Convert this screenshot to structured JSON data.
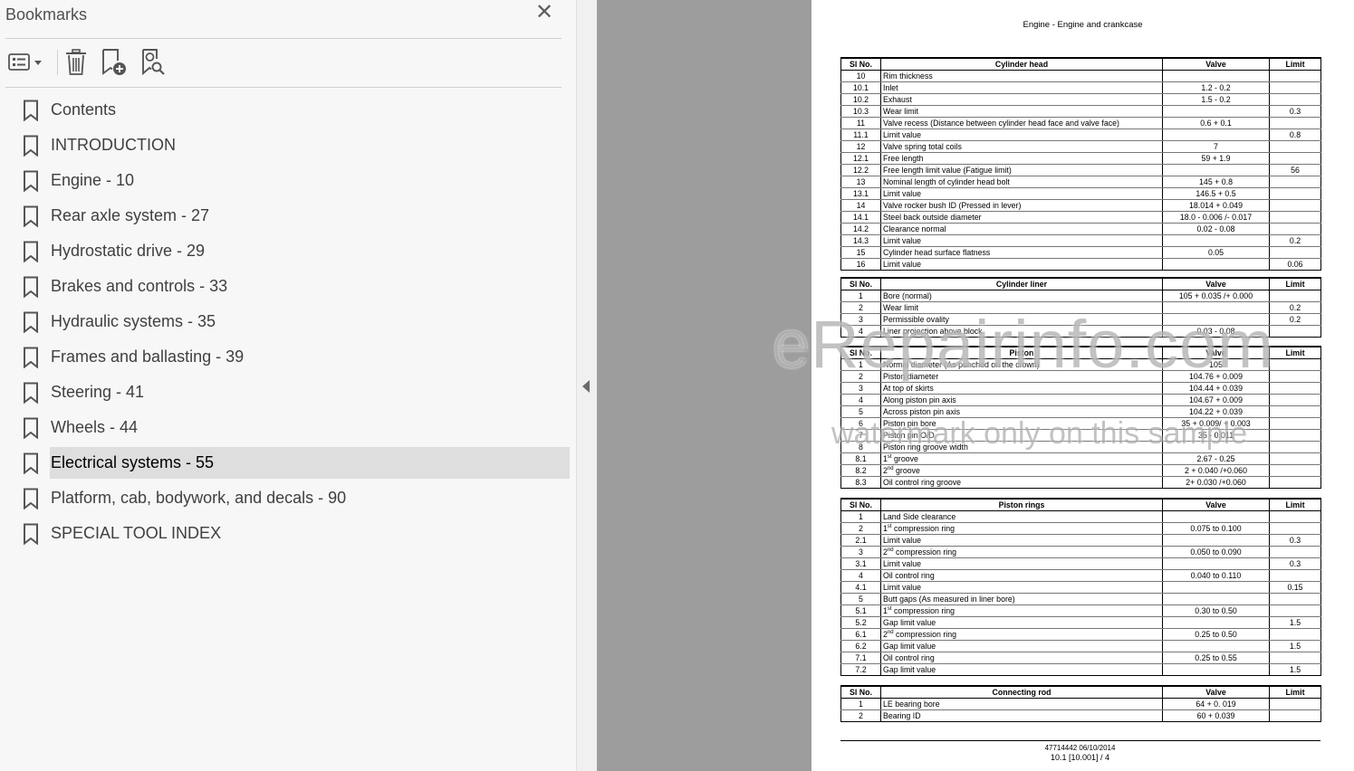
{
  "panel": {
    "title": "Bookmarks",
    "close_symbol": "✕"
  },
  "toolbar": {
    "options": {
      "icon": "list-options-icon"
    },
    "delete": {
      "icon": "trash-icon"
    },
    "new_bookmark": {
      "icon": "add-bookmark-icon"
    },
    "find_bookmark": {
      "icon": "find-bookmark-icon"
    }
  },
  "bookmarks": [
    {
      "label": "Contents"
    },
    {
      "label": "INTRODUCTION"
    },
    {
      "label": "Engine - 10"
    },
    {
      "label": "Rear axle system - 27"
    },
    {
      "label": "Hydrostatic drive - 29"
    },
    {
      "label": "Brakes and controls - 33"
    },
    {
      "label": "Hydraulic systems - 35"
    },
    {
      "label": "Frames and ballasting - 39"
    },
    {
      "label": "Steering - 41"
    },
    {
      "label": "Wheels - 44"
    },
    {
      "label": "Electrical systems - 55",
      "selected": true
    },
    {
      "label": "Platform, cab, bodywork, and decals - 90"
    },
    {
      "label": "SPECIAL TOOL INDEX"
    }
  ],
  "document": {
    "header": "Engine - Engine and crankcase",
    "tables": [
      {
        "headers": [
          "Sl No.",
          "Cylinder head",
          "Valve",
          "Limit"
        ],
        "rows": [
          [
            "10",
            "Rim thickness",
            "",
            ""
          ],
          [
            "10.1",
            "Inlet",
            "1.2 - 0.2",
            ""
          ],
          [
            "10.2",
            "Exhaust",
            "1.5 - 0.2",
            ""
          ],
          [
            "10.3",
            "Wear limit",
            "",
            "0.3"
          ],
          [
            "11",
            "Valve recess (Distance between cylinder head face and valve face)",
            "0.6 + 0.1",
            ""
          ],
          [
            "11.1",
            "Limit value",
            "",
            "0.8"
          ],
          [
            "12",
            "Valve spring total coils",
            "7",
            ""
          ],
          [
            "12.1",
            "Free length",
            "59 + 1.9",
            ""
          ],
          [
            "12.2",
            "Free length limit value (Fatigue limit)",
            "",
            "56"
          ],
          [
            "13",
            "Nominal length of cylinder head bolt",
            "145 + 0.8",
            ""
          ],
          [
            "13.1",
            "Limit value",
            "146.5 + 0.5",
            ""
          ],
          [
            "14",
            "Valve rocker bush ID (Pressed in lever)",
            "18.014 + 0.049",
            ""
          ],
          [
            "14.1",
            "Steel back outside diameter",
            "18.0 - 0.006 /- 0.017",
            ""
          ],
          [
            "14.2",
            "Clearance normal",
            "0.02 - 0.08",
            ""
          ],
          [
            "14.3",
            "Limit value",
            "",
            "0.2"
          ],
          [
            "15",
            "Cylinder head surface flatness",
            "0.05",
            ""
          ],
          [
            "16",
            "Limit value",
            "",
            "0.06"
          ]
        ]
      },
      {
        "headers": [
          "Sl No.",
          "Cylinder liner",
          "Valve",
          "Limit"
        ],
        "rows": [
          [
            "1",
            "Bore (normal)",
            "105 + 0.035 /+ 0.000",
            ""
          ],
          [
            "2",
            "Wear limit",
            "",
            "0.2"
          ],
          [
            "3",
            "Permissible ovality",
            "",
            "0.2"
          ],
          [
            "4",
            "Liner projection above block",
            "0.03 - 0.08",
            ""
          ]
        ]
      },
      {
        "headers": [
          "Sl No.",
          "Piston",
          "Valve",
          "Limit"
        ],
        "rows": [
          [
            "1",
            "Normal diameter (As punched on the crown)",
            "105",
            ""
          ],
          [
            "2",
            "Piston diameter",
            "104.76 + 0.009",
            ""
          ],
          [
            "3",
            "At top of skirts",
            "104.44 + 0.039",
            ""
          ],
          [
            "4",
            "Along piston pin axis",
            "104.67 + 0.009",
            ""
          ],
          [
            "5",
            "Across piston pin axis",
            "104.22 + 0.039",
            ""
          ],
          [
            "6",
            "Piston pin bore",
            "35 + 0.009/ + 0.003",
            ""
          ],
          [
            "7",
            "Piston pin O/D",
            "35 - 0.011",
            ""
          ],
          [
            "8",
            "Piston ring groove width",
            "",
            ""
          ],
          [
            "8.1",
            "1|st| groove",
            "2.67 - 0.25",
            ""
          ],
          [
            "8.2",
            "2|nd| groove",
            "2 + 0.040 /+0.060",
            ""
          ],
          [
            "8.3",
            "Oil control ring groove",
            "2+ 0.030 /+0.060",
            ""
          ]
        ]
      },
      {
        "headers": [
          "Sl No.",
          "Piston rings",
          "Valve",
          "Limit"
        ],
        "rows": [
          [
            "1",
            "Land Side clearance",
            "",
            ""
          ],
          [
            "2",
            "1|st| compression ring",
            "0.075 to 0.100",
            ""
          ],
          [
            "2.1",
            "Limit value",
            "",
            "0.3"
          ],
          [
            "3",
            "2|nd| compression ring",
            "0.050 to 0.090",
            ""
          ],
          [
            "3.1",
            "Limit value",
            "",
            "0.3"
          ],
          [
            "4",
            "Oil control ring",
            "0.040 to 0.110",
            ""
          ],
          [
            "4.1",
            "Limit value",
            "",
            "0.15"
          ],
          [
            "5",
            "Butt gaps (As measured in liner bore)",
            "",
            ""
          ],
          [
            "5.1",
            "1|st| compression ring",
            "0.30 to 0.50",
            ""
          ],
          [
            "5.2",
            "Gap limit value",
            "",
            "1.5"
          ],
          [
            "6.1",
            "2|nd| compression ring",
            "0.25 to 0.50",
            ""
          ],
          [
            "6.2",
            "Gap limit value",
            "",
            "1.5"
          ],
          [
            "7.1",
            "Oil control ring",
            "0.25 to 0.55",
            ""
          ],
          [
            "7.2",
            "Gap limit value",
            "",
            "1.5"
          ]
        ]
      },
      {
        "headers": [
          "Sl No.",
          "Connecting rod",
          "Valve",
          "Limit"
        ],
        "rows": [
          [
            "1",
            "LE bearing bore",
            "64 + 0. 019",
            ""
          ],
          [
            "2",
            "Bearing ID",
            "60 + 0.039",
            ""
          ]
        ]
      }
    ],
    "footer_line1": "47714442 06/10/2014",
    "footer_line2": "10.1 [10.001] / 4",
    "watermark_main": "eRepairinfo.com",
    "watermark_sub": "watermark only on this sample"
  }
}
